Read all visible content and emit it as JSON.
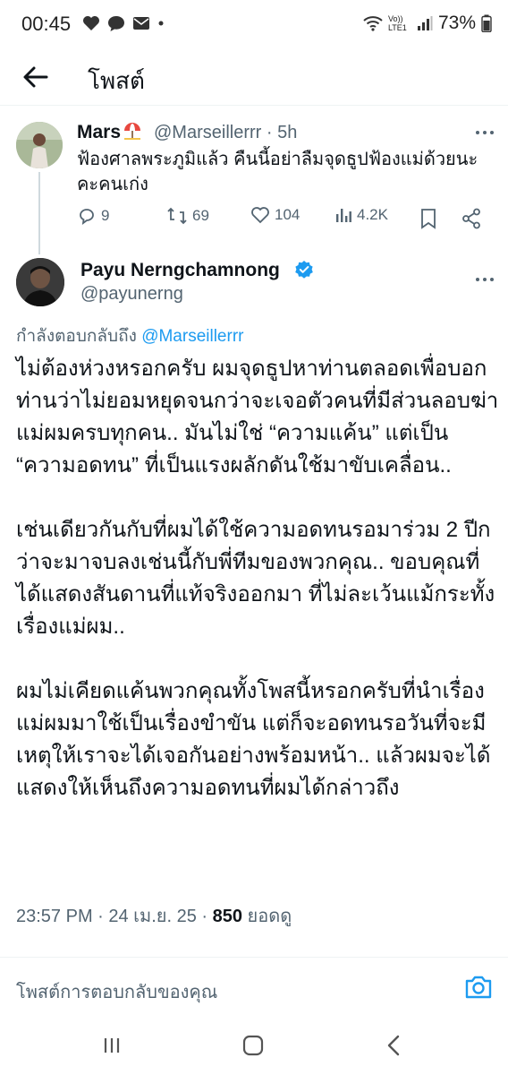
{
  "status_bar": {
    "time": "00:45",
    "network_label": "Vo)) LTE1",
    "battery": "73%",
    "icons": [
      "heart-icon",
      "chat-icon",
      "mail-icon",
      "dot-icon",
      "wifi-icon",
      "signal-icon",
      "battery-icon"
    ]
  },
  "header": {
    "title": "โพสต์"
  },
  "parent_tweet": {
    "name": "Mars",
    "handle_time": "@Marseillerrr · 5h",
    "text": "ฟ้องศาลพระภูมิแล้ว คืนนี้อย่าลืมจุดธูปฟ้องแม่ด้วยนะคะคนเก่ง",
    "replies": "9",
    "reposts": "69",
    "likes": "104",
    "views": "4.2K"
  },
  "main_tweet": {
    "name": "Payu Nerngchamnong",
    "handle": "@payunerng",
    "reply_prefix": "กำลังตอบกลับถึง",
    "reply_mention": "@Marseillerrr",
    "paragraphs": [
      "ไม่ต้องห่วงหรอกครับ ผมจุดธูปหาท่านตลอดเพื่อบอกท่านว่าไม่ยอมหยุดจนกว่าจะเจอตัวคนที่มีส่วนลอบฆ่าแม่ผมครบทุกคน.. มันไม่ใช่ “ความแค้น” แต่เป็น “ความอดทน” ที่เป็นแรงผลักดันใช้มาขับเคลื่อน..",
      "เช่นเดียวกันกับที่ผมได้ใช้ความอดทนรอมาร่วม 2 ปีกว่าจะมาจบลงเช่นนี้กับพี่ทีมของพวกคุณ.. ขอบคุณที่ได้แสดงสันดานที่แท้จริงออกมา ที่ไม่ละเว้นแม้กระทั้งเรื่องแม่ผม..",
      "ผมไม่เคียดแค้นพวกคุณทั้งโพสนี้หรอกครับที่นำเรื่องแม่ผมมาใช้เป็นเรื่องขำขัน แต่ก็จะอดทนรอวันที่จะมีเหตุให้เราจะได้เจอกันอย่างพร้อมหน้า.. แล้วผมจะได้แสดงให้เห็นถึงความอดทนที่ผมได้กล่าวถึง"
    ],
    "meta_time": "23:57 PM · 24 เม.ย. 25 · ",
    "views_count": "850",
    "views_label": " ยอดดู"
  },
  "reply_bar": {
    "placeholder": "โพสต์การตอบกลับของคุณ"
  },
  "colors": {
    "text": "#0f1419",
    "secondary": "#536471",
    "accent": "#1d9bf0",
    "divider": "#eff3f4"
  }
}
